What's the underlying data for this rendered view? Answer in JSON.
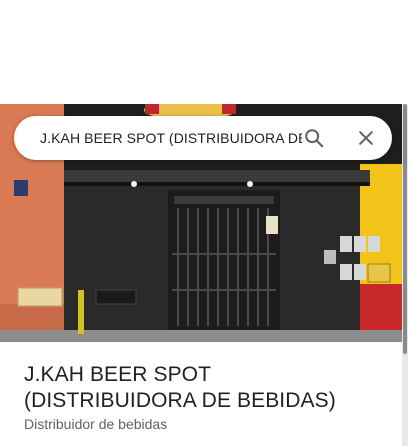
{
  "search": {
    "query": "J.KAH BEER SPOT (DISTRIBUIDORA DE BEBIDAS)"
  },
  "place": {
    "title": "J.KAH BEER SPOT (DISTRIBUIDORA DE BEBIDAS)",
    "category": "Distribuidor de bebidas"
  },
  "icons": {
    "search": "search-icon",
    "close": "close-icon"
  },
  "colors": {
    "text_primary": "#202124",
    "text_secondary": "#5f6368",
    "icon": "#5f6368",
    "facade_left": "#d97a55",
    "facade_right": "#f2c318",
    "facade_right_bottom": "#c8282a"
  }
}
